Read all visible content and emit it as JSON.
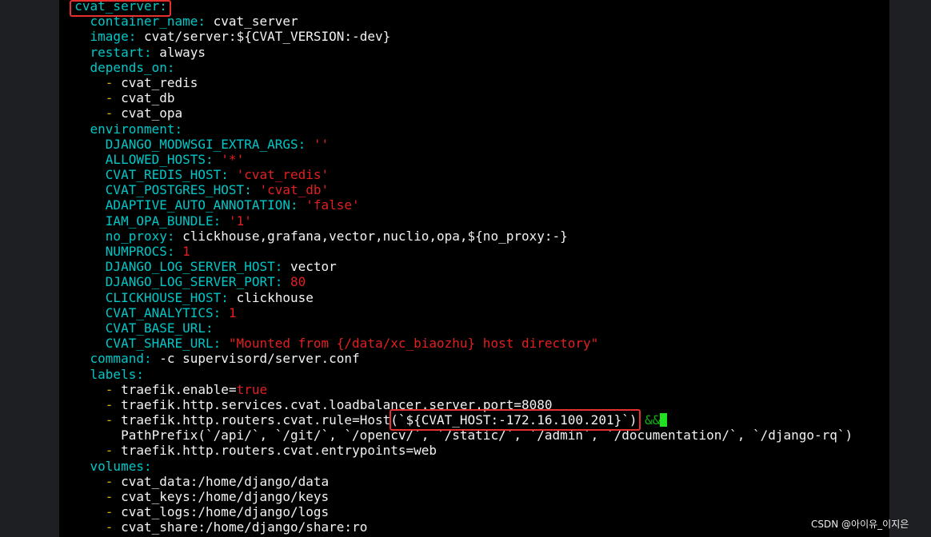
{
  "header": {
    "service": "cvat_server",
    "service_colon": ":"
  },
  "container_name": {
    "key": "container_name",
    "value": "cvat_server"
  },
  "image": {
    "key": "image",
    "value": "cvat/server:${CVAT_VERSION:-dev}"
  },
  "restart": {
    "key": "restart",
    "value": "always"
  },
  "depends_on": {
    "key": "depends_on",
    "items": [
      "cvat_redis",
      "cvat_db",
      "cvat_opa"
    ]
  },
  "environment": {
    "key": "environment",
    "vars": [
      {
        "key": "DJANGO_MODWSGI_EXTRA_ARGS",
        "value": "''"
      },
      {
        "key": "ALLOWED_HOSTS",
        "value": "'*'"
      },
      {
        "key": "CVAT_REDIS_HOST",
        "value": "'cvat_redis'"
      },
      {
        "key": "CVAT_POSTGRES_HOST",
        "value": "'cvat_db'"
      },
      {
        "key": "ADAPTIVE_AUTO_ANNOTATION",
        "value": "'false'"
      },
      {
        "key": "IAM_OPA_BUNDLE",
        "value": "'1'"
      },
      {
        "key": "no_proxy",
        "value": "clickhouse,grafana,vector,nuclio,opa,${no_proxy:-}"
      },
      {
        "key": "NUMPROCS",
        "value": "1"
      },
      {
        "key": "DJANGO_LOG_SERVER_HOST",
        "value": "vector"
      },
      {
        "key": "DJANGO_LOG_SERVER_PORT",
        "value": "80"
      },
      {
        "key": "CLICKHOUSE_HOST",
        "value": "clickhouse"
      },
      {
        "key": "CVAT_ANALYTICS",
        "value": "1"
      },
      {
        "key": "CVAT_BASE_URL",
        "value": ""
      },
      {
        "key": "CVAT_SHARE_URL",
        "value": "\"Mounted from {/data/xc_biaozhu} host directory\""
      }
    ]
  },
  "command": {
    "key": "command",
    "value": "-c supervisord/server.conf"
  },
  "labels": {
    "key": "labels",
    "traefik_enable": {
      "prefix": "traefik.enable=",
      "value": "true"
    },
    "port": "traefik.http.services.cvat.loadbalancer.server.port=8080",
    "rule_prefix": "traefik.http.routers.cvat.rule=Host(",
    "rule_host": "`${CVAT_HOST:-172.16.100.201}`)",
    "rule_and": "&&",
    "path_prefix": "PathPrefix(`/api/`, `/git/`, `/opencv/`, `/static/`, `/admin`, `/documentation/`, `/django-rq`)",
    "entrypoints": "traefik.http.routers.cvat.entrypoints=web"
  },
  "volumes": {
    "key": "volumes",
    "items": [
      "cvat_data:/home/django/data",
      "cvat_keys:/home/django/keys",
      "cvat_logs:/home/django/logs",
      "cvat_share:/home/django/share:ro"
    ]
  },
  "watermark": "CSDN @아이유_이지은",
  "colors": {
    "key": "#00c7c7",
    "dash": "#e0b000",
    "string": "#e02020",
    "text": "#f2f2f2",
    "highlight_box": "#e53030",
    "cursor": "#22e022"
  }
}
